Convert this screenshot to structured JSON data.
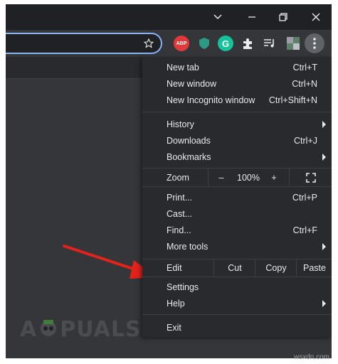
{
  "toolbar": {
    "ext_abp": "ABP",
    "ext_grammarly": "G"
  },
  "menu": {
    "group1": [
      {
        "label": "New tab",
        "shortcut": "Ctrl+T"
      },
      {
        "label": "New window",
        "shortcut": "Ctrl+N"
      },
      {
        "label": "New Incognito window",
        "shortcut": "Ctrl+Shift+N"
      }
    ],
    "history": {
      "label": "History"
    },
    "downloads": {
      "label": "Downloads",
      "shortcut": "Ctrl+J"
    },
    "bookmarks": {
      "label": "Bookmarks"
    },
    "zoom": {
      "label": "Zoom",
      "minus": "–",
      "level": "100%",
      "plus": "+"
    },
    "print": {
      "label": "Print...",
      "shortcut": "Ctrl+P"
    },
    "cast": {
      "label": "Cast..."
    },
    "find": {
      "label": "Find...",
      "shortcut": "Ctrl+F"
    },
    "more_tools": {
      "label": "More tools"
    },
    "edit": {
      "label": "Edit",
      "cut": "Cut",
      "copy": "Copy",
      "paste": "Paste"
    },
    "settings": {
      "label": "Settings"
    },
    "help": {
      "label": "Help"
    },
    "exit": {
      "label": "Exit"
    }
  },
  "branding": {
    "logo_a": "A",
    "logo_rest": "PUALS",
    "watermark": "wsxdn.com"
  },
  "colors": {
    "accent": "#8ab4f8",
    "menu_bg": "#292a2d",
    "arrow": "#e3221b"
  }
}
